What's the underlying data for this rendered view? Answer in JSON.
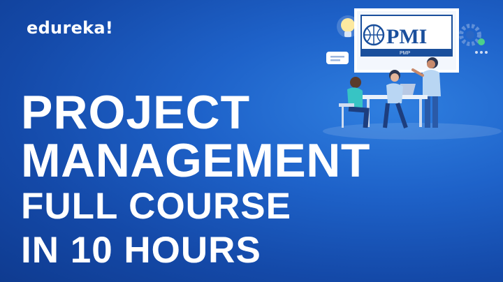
{
  "brand": {
    "name": "edureka!"
  },
  "headline": {
    "line1": "PROJECT",
    "line2": "MANAGEMENT",
    "line3": "FULL COURSE",
    "line4": "IN 10 HOURS"
  },
  "illustration": {
    "board_logo": "PMI",
    "board_caption": "PMP",
    "icons": [
      "lightbulb-icon",
      "gear-icon",
      "chat-bubble-icon",
      "check-icon",
      "more-icon"
    ]
  },
  "colors": {
    "background": "#1a57be",
    "text": "#ffffff",
    "board_accent": "#1a4f9c"
  }
}
